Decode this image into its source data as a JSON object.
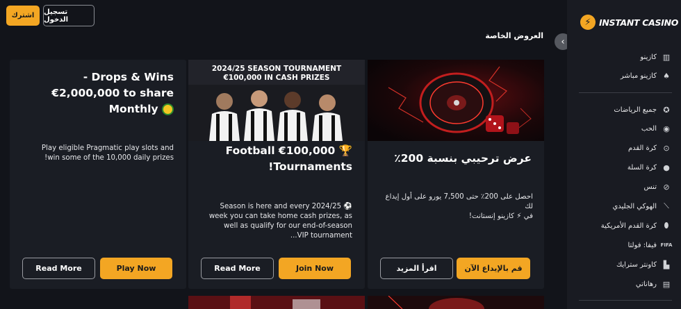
{
  "header": {
    "join_label": "اشترك",
    "login_label": "تسجيل الدخول",
    "section_title": "العروض الخاصة"
  },
  "sidebar": {
    "brand": "INSTANT CASINO",
    "items": [
      {
        "label": "كازينو",
        "icon": "slot-machine-icon"
      },
      {
        "label": "كازينو مباشر",
        "icon": "cards-icon"
      },
      {
        "label": "جميع الرياضات",
        "icon": "sports-star-icon"
      },
      {
        "label": "الحب",
        "icon": "live-broadcast-icon"
      },
      {
        "label": "كرة القدم",
        "icon": "soccer-ball-icon"
      },
      {
        "label": "كرة السلة",
        "icon": "basketball-icon"
      },
      {
        "label": "تنس",
        "icon": "tennis-racket-icon"
      },
      {
        "label": "الهوكي الجليدي",
        "icon": "hockey-stick-icon"
      },
      {
        "label": "كرة القدم الأمريكية",
        "icon": "american-football-icon"
      },
      {
        "label": "فيفا: فولتا",
        "icon": "fifa-icon"
      },
      {
        "label": "كاونتر سترايك",
        "icon": "counter-strike-icon"
      },
      {
        "label": "رهاناتي",
        "icon": "bet-slip-icon"
      }
    ]
  },
  "cards": [
    {
      "title": "عرض ترحيبي بنسبة 200٪",
      "desc_line1": "احصل على 200٪ حتى 7,500 يورو على أول إيداع لك",
      "desc_line2": "في ⚡ كازينو إنستانت!",
      "primary_label": "قم بالإيداع الآن",
      "secondary_label": "اقرأ المزيد"
    },
    {
      "banner_line1": "2024/25 SEASON TOURNAMENT",
      "banner_line2": "€100,000 IN CASH PRIZES",
      "title_line1": "Football €100,000 🏆",
      "title_line2": "!Tournaments",
      "desc_lines": [
        "Season is here and every 2024/25 ⚽",
        "week you can take home cash prizes, as",
        "well as qualify for our end-of-season",
        "...VIP tournament"
      ],
      "primary_label": "Join Now",
      "secondary_label": "Read More"
    },
    {
      "title_line1": "- Drops & Wins",
      "title_line2": "€2,000,000 to share",
      "title_line3": "Monthly",
      "desc_lines": [
        "Play eligible Pragmatic play slots and",
        "!win some of the 10,000 daily prizes"
      ],
      "primary_label": "Play Now",
      "secondary_label": "Read More"
    }
  ],
  "colors": {
    "accent": "#f3a623",
    "background": "#12141a",
    "card": "#1a1d24",
    "sidebar": "#191b22"
  }
}
